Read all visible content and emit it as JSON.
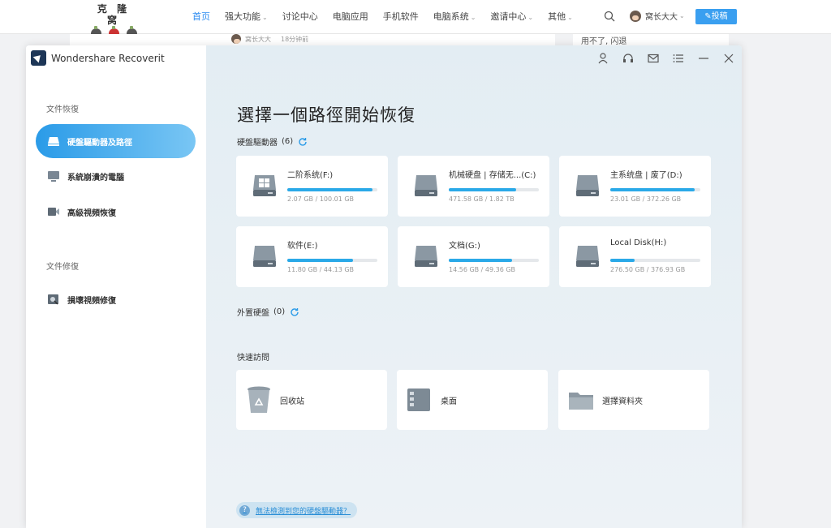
{
  "site": {
    "logo_text": "克 隆 窝",
    "nav": [
      {
        "label": "首页",
        "active": true,
        "dropdown": false
      },
      {
        "label": "强大功能",
        "active": false,
        "dropdown": true
      },
      {
        "label": "讨论中心",
        "active": false,
        "dropdown": false
      },
      {
        "label": "电脑应用",
        "active": false,
        "dropdown": false
      },
      {
        "label": "手机软件",
        "active": false,
        "dropdown": false
      },
      {
        "label": "电脑系统",
        "active": false,
        "dropdown": true
      },
      {
        "label": "邀请中心",
        "active": false,
        "dropdown": true
      },
      {
        "label": "其他",
        "active": false,
        "dropdown": true
      }
    ],
    "user_name": "窝长大大",
    "post_button": "投稿",
    "bg_author": "窝长大大",
    "bg_time": "18分钟前",
    "bg_text": "用不了, 闪退"
  },
  "app": {
    "title": "Wondershare Recoverit",
    "sidebar": {
      "section_recover": "文件恢復",
      "section_repair": "文件修復",
      "items": [
        {
          "label": "硬盤驅動器及路徑",
          "icon": "hard-drive-icon",
          "active": true
        },
        {
          "label": "系統崩潰的電腦",
          "icon": "monitor-icon",
          "active": false
        },
        {
          "label": "高級視頻恢復",
          "icon": "video-camera-icon",
          "active": false
        },
        {
          "label": "損壞視頻修復",
          "icon": "video-repair-icon",
          "active": false
        }
      ]
    },
    "main": {
      "title": "選擇一個路徑開始恢復",
      "drives_label": "硬盤驅動器",
      "drives_count": "(6)",
      "external_label": "外置硬盤",
      "external_count": "(0)",
      "quick_label": "快速訪問",
      "drives": [
        {
          "name": "二阶系统(F:)",
          "size": "2.07 GB / 100.01 GB",
          "fill": 0.95,
          "windows": true
        },
        {
          "name": "机械硬盘 | 存储无...(C:)",
          "size": "471.58 GB / 1.82 TB",
          "fill": 0.75,
          "windows": false
        },
        {
          "name": "主系统盘 | 废了(D:)",
          "size": "23.01 GB / 372.26 GB",
          "fill": 0.94,
          "windows": false
        },
        {
          "name": "软件(E:)",
          "size": "11.80 GB / 44.13 GB",
          "fill": 0.73,
          "windows": false
        },
        {
          "name": "文档(G:)",
          "size": "14.56 GB / 49.36 GB",
          "fill": 0.7,
          "windows": false
        },
        {
          "name": "Local Disk(H:)",
          "size": "276.50 GB / 376.93 GB",
          "fill": 0.27,
          "windows": false
        }
      ],
      "quick": [
        {
          "label": "回收站",
          "icon": "recycle-bin-icon"
        },
        {
          "label": "桌面",
          "icon": "desktop-icon"
        },
        {
          "label": "選擇資料夾",
          "icon": "folder-icon"
        }
      ],
      "help_link": "無法檢測到您的硬盤驅動器？"
    },
    "colors": {
      "accent": "#2a9be8",
      "bar_fill": "#2aa9e8",
      "drive_icon": "#6f7d88"
    }
  }
}
